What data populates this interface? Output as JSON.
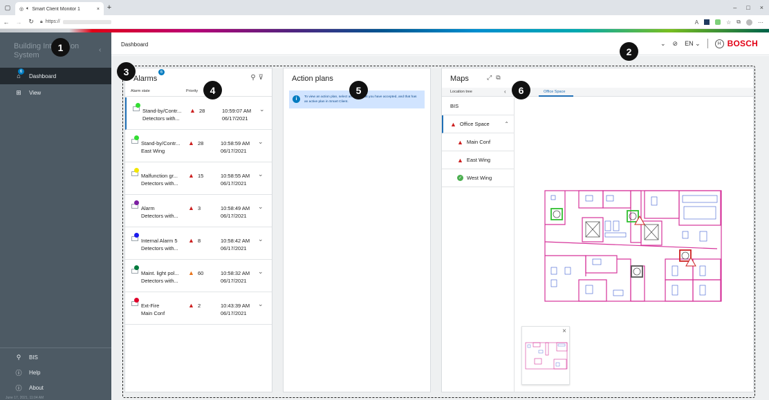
{
  "browser": {
    "tab_title": "Smart Client Monitor 1",
    "tab_close": "×",
    "new_tab": "+",
    "url_prefix": "https://",
    "min": "–",
    "max": "□",
    "close": "×"
  },
  "sidebar": {
    "brand": "Building Integration System",
    "collapse": "‹",
    "items": [
      {
        "label": "Dashboard",
        "badge": "6",
        "icon": "home-icon"
      },
      {
        "label": "View",
        "icon": "grid-icon"
      }
    ],
    "bottom_items": [
      {
        "label": "BIS",
        "icon": "user-icon"
      },
      {
        "label": "Help",
        "icon": "help-icon"
      },
      {
        "label": "About",
        "icon": "info-icon"
      }
    ],
    "footer": "June 17, 2021, 11:04 AM"
  },
  "header": {
    "breadcrumb": "Dashboard",
    "lang": "EN",
    "brand": "BOSCH"
  },
  "alarms": {
    "title": "Alarms",
    "badge": "6",
    "col_state": "Alarm state",
    "col_priority": "Priority",
    "rows": [
      {
        "name": "Stand-by/Contr...",
        "sub": "Detectors with...",
        "priority": "28",
        "time": "10:59:07 AM",
        "date": "06/17/2021",
        "dot": "#33dd33",
        "warn": "#cc1f1f"
      },
      {
        "name": "Stand-by/Contr...",
        "sub": "East Wing",
        "priority": "28",
        "time": "10:58:59 AM",
        "date": "06/17/2021",
        "dot": "#33dd33",
        "warn": "#cc1f1f"
      },
      {
        "name": "Malfunction gr...",
        "sub": "Detectors with...",
        "priority": "15",
        "time": "10:58:55 AM",
        "date": "06/17/2021",
        "dot": "#f2e600",
        "warn": "#cc1f1f"
      },
      {
        "name": "Alarm",
        "sub": "Detectors with...",
        "priority": "3",
        "time": "10:58:49 AM",
        "date": "06/17/2021",
        "dot": "#7b1fa2",
        "warn": "#cc1f1f"
      },
      {
        "name": "Internal Alarm 5",
        "sub": "Detectors with...",
        "priority": "8",
        "time": "10:58:42 AM",
        "date": "06/17/2021",
        "dot": "#1a1aee",
        "warn": "#cc1f1f"
      },
      {
        "name": "Maint. light pol...",
        "sub": "Detectors with...",
        "priority": "60",
        "time": "10:58:32 AM",
        "date": "06/17/2021",
        "dot": "#007a3d",
        "warn": "#e8731a"
      },
      {
        "name": "Ext-Fire",
        "sub": "Main Conf",
        "priority": "2",
        "time": "10:43:39 AM",
        "date": "06/17/2021",
        "dot": "#e0002a",
        "warn": "#cc1f1f"
      }
    ]
  },
  "action_plans": {
    "title": "Action plans",
    "info": "To view an action plan, select an alarm that you have accepted, and that has an active plan in Smart Client."
  },
  "maps": {
    "title": "Maps",
    "location_tree": "Location tree",
    "active_tab": "Office Space",
    "tree": [
      {
        "label": "BIS",
        "status": "none"
      },
      {
        "label": "Office Space",
        "status": "alarm"
      },
      {
        "label": "Main Conf",
        "status": "alarm"
      },
      {
        "label": "East Wing",
        "status": "alarm"
      },
      {
        "label": "West Wing",
        "status": "ok"
      }
    ]
  },
  "callouts": [
    "1",
    "2",
    "3",
    "4",
    "5",
    "6"
  ],
  "colors": {
    "sidebar_bg": "#4d5a64",
    "active_bg": "#232a30",
    "accent": "#007bc0",
    "bosch_red": "#e20015",
    "floor_lines": "#d6339a"
  }
}
